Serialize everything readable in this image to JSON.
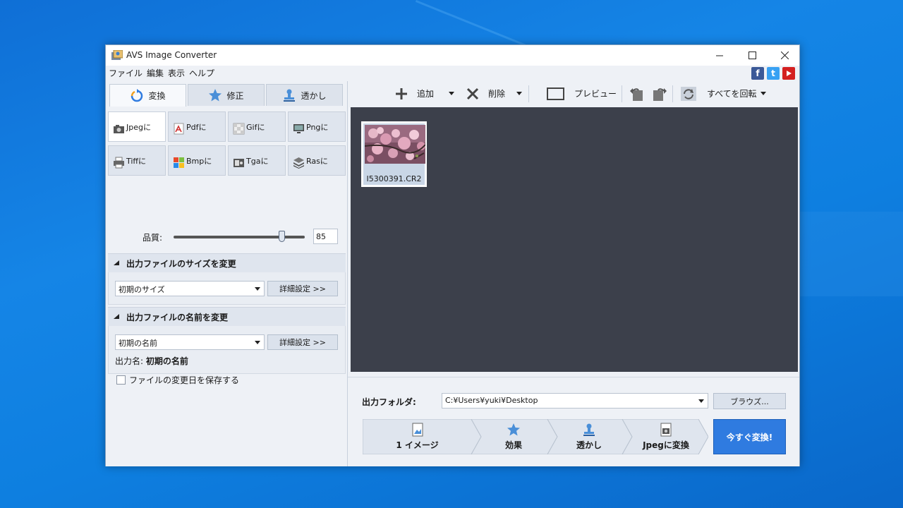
{
  "window": {
    "title": "AVS Image Converter"
  },
  "menu": [
    "ファイル",
    "編集",
    "表示",
    "ヘルプ"
  ],
  "social": [
    "facebook-icon",
    "twitter-icon",
    "youtube-icon"
  ],
  "tabs": [
    {
      "label": "変換",
      "icon": "convert-icon",
      "active": true
    },
    {
      "label": "修正",
      "icon": "star-icon",
      "active": false
    },
    {
      "label": "透かし",
      "icon": "stamp-icon",
      "active": false
    }
  ],
  "formats": [
    {
      "label": "Jpegに",
      "icon": "camera-icon",
      "selected": true
    },
    {
      "label": "Pdfに",
      "icon": "pdf-icon",
      "selected": false
    },
    {
      "label": "Gifに",
      "icon": "gif-icon",
      "selected": false
    },
    {
      "label": "Pngに",
      "icon": "monitor-icon",
      "selected": false
    },
    {
      "label": "Tiffに",
      "icon": "printer-icon",
      "selected": false
    },
    {
      "label": "Bmpに",
      "icon": "windows-icon",
      "selected": false
    },
    {
      "label": "Tgaに",
      "icon": "tga-icon",
      "selected": false
    },
    {
      "label": "Rasに",
      "icon": "layers-icon",
      "selected": false
    }
  ],
  "quality": {
    "label": "品質:",
    "value": "85"
  },
  "resize": {
    "heading": "出力ファイルのサイズを変更",
    "dropdown": "初期のサイズ",
    "advanced": "詳細設定 >>"
  },
  "rename": {
    "heading": "出力ファイルの名前を変更",
    "dropdown": "初期の名前",
    "advanced": "詳細設定 >>",
    "output_name_label": "出力名:",
    "output_name_value": "初期の名前"
  },
  "keep_date": {
    "label": "ファイルの変更日を保存する",
    "checked": false
  },
  "toolbar": {
    "add": "追加",
    "delete": "削除",
    "preview": "プレビュー",
    "rotate_all": "すべてを回転"
  },
  "files": [
    {
      "name": "I5300391.CR2"
    }
  ],
  "output": {
    "label": "出力フォルダ:",
    "path": "C:¥Users¥yuki¥Desktop",
    "browse": "ブラウズ..."
  },
  "steps": [
    {
      "label": "1 イメージ",
      "icon": "image-icon"
    },
    {
      "label": "効果",
      "icon": "star-icon"
    },
    {
      "label": "透かし",
      "icon": "stamp-icon"
    },
    {
      "label": "Jpegに変換",
      "icon": "camera-icon"
    }
  ],
  "convert_button": "今すぐ変換!",
  "colors": {
    "accent": "#2f7be0",
    "preview_bg": "#3c404b",
    "desktop": "#1585e6"
  }
}
